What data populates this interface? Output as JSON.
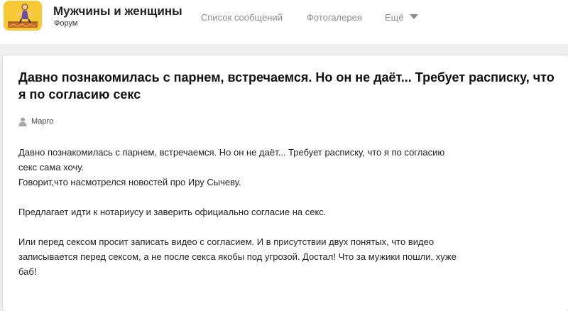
{
  "site": {
    "title": "Мужчины и женщины",
    "subtitle": "Форум"
  },
  "nav": {
    "items": [
      "Список сообщений",
      "Фотогалерея",
      "Ещё"
    ],
    "more_icon": "chevron-down-icon"
  },
  "post": {
    "title": "Давно познакомилась с парнем, встречаемся. Но он не даёт... Требует расписку, что я по согласию секс",
    "author": "Марго",
    "author_icon": "user-icon",
    "paragraphs": [
      "Давно познакомилась с парнем, встречаемся. Но он не даёт... Требует расписку, что я по согласию секс сама хочу.\nГоворит,что насмотрелся новостей про Иру Сычеву.",
      "Предлагает идти к нотариусу и заверить официально согласие на секс.",
      "Или перед сексом просит записать видео с согласием. И в присутствии двух понятых, что видео записывается перед сексом, а не после секса якобы под угрозой. Достал! Что за мужики пошли, хуже баб!"
    ]
  },
  "colors": {
    "logo_bg": "#f6c935",
    "nav_text": "#8c8c8c",
    "page_bg": "#f0f0f0"
  }
}
